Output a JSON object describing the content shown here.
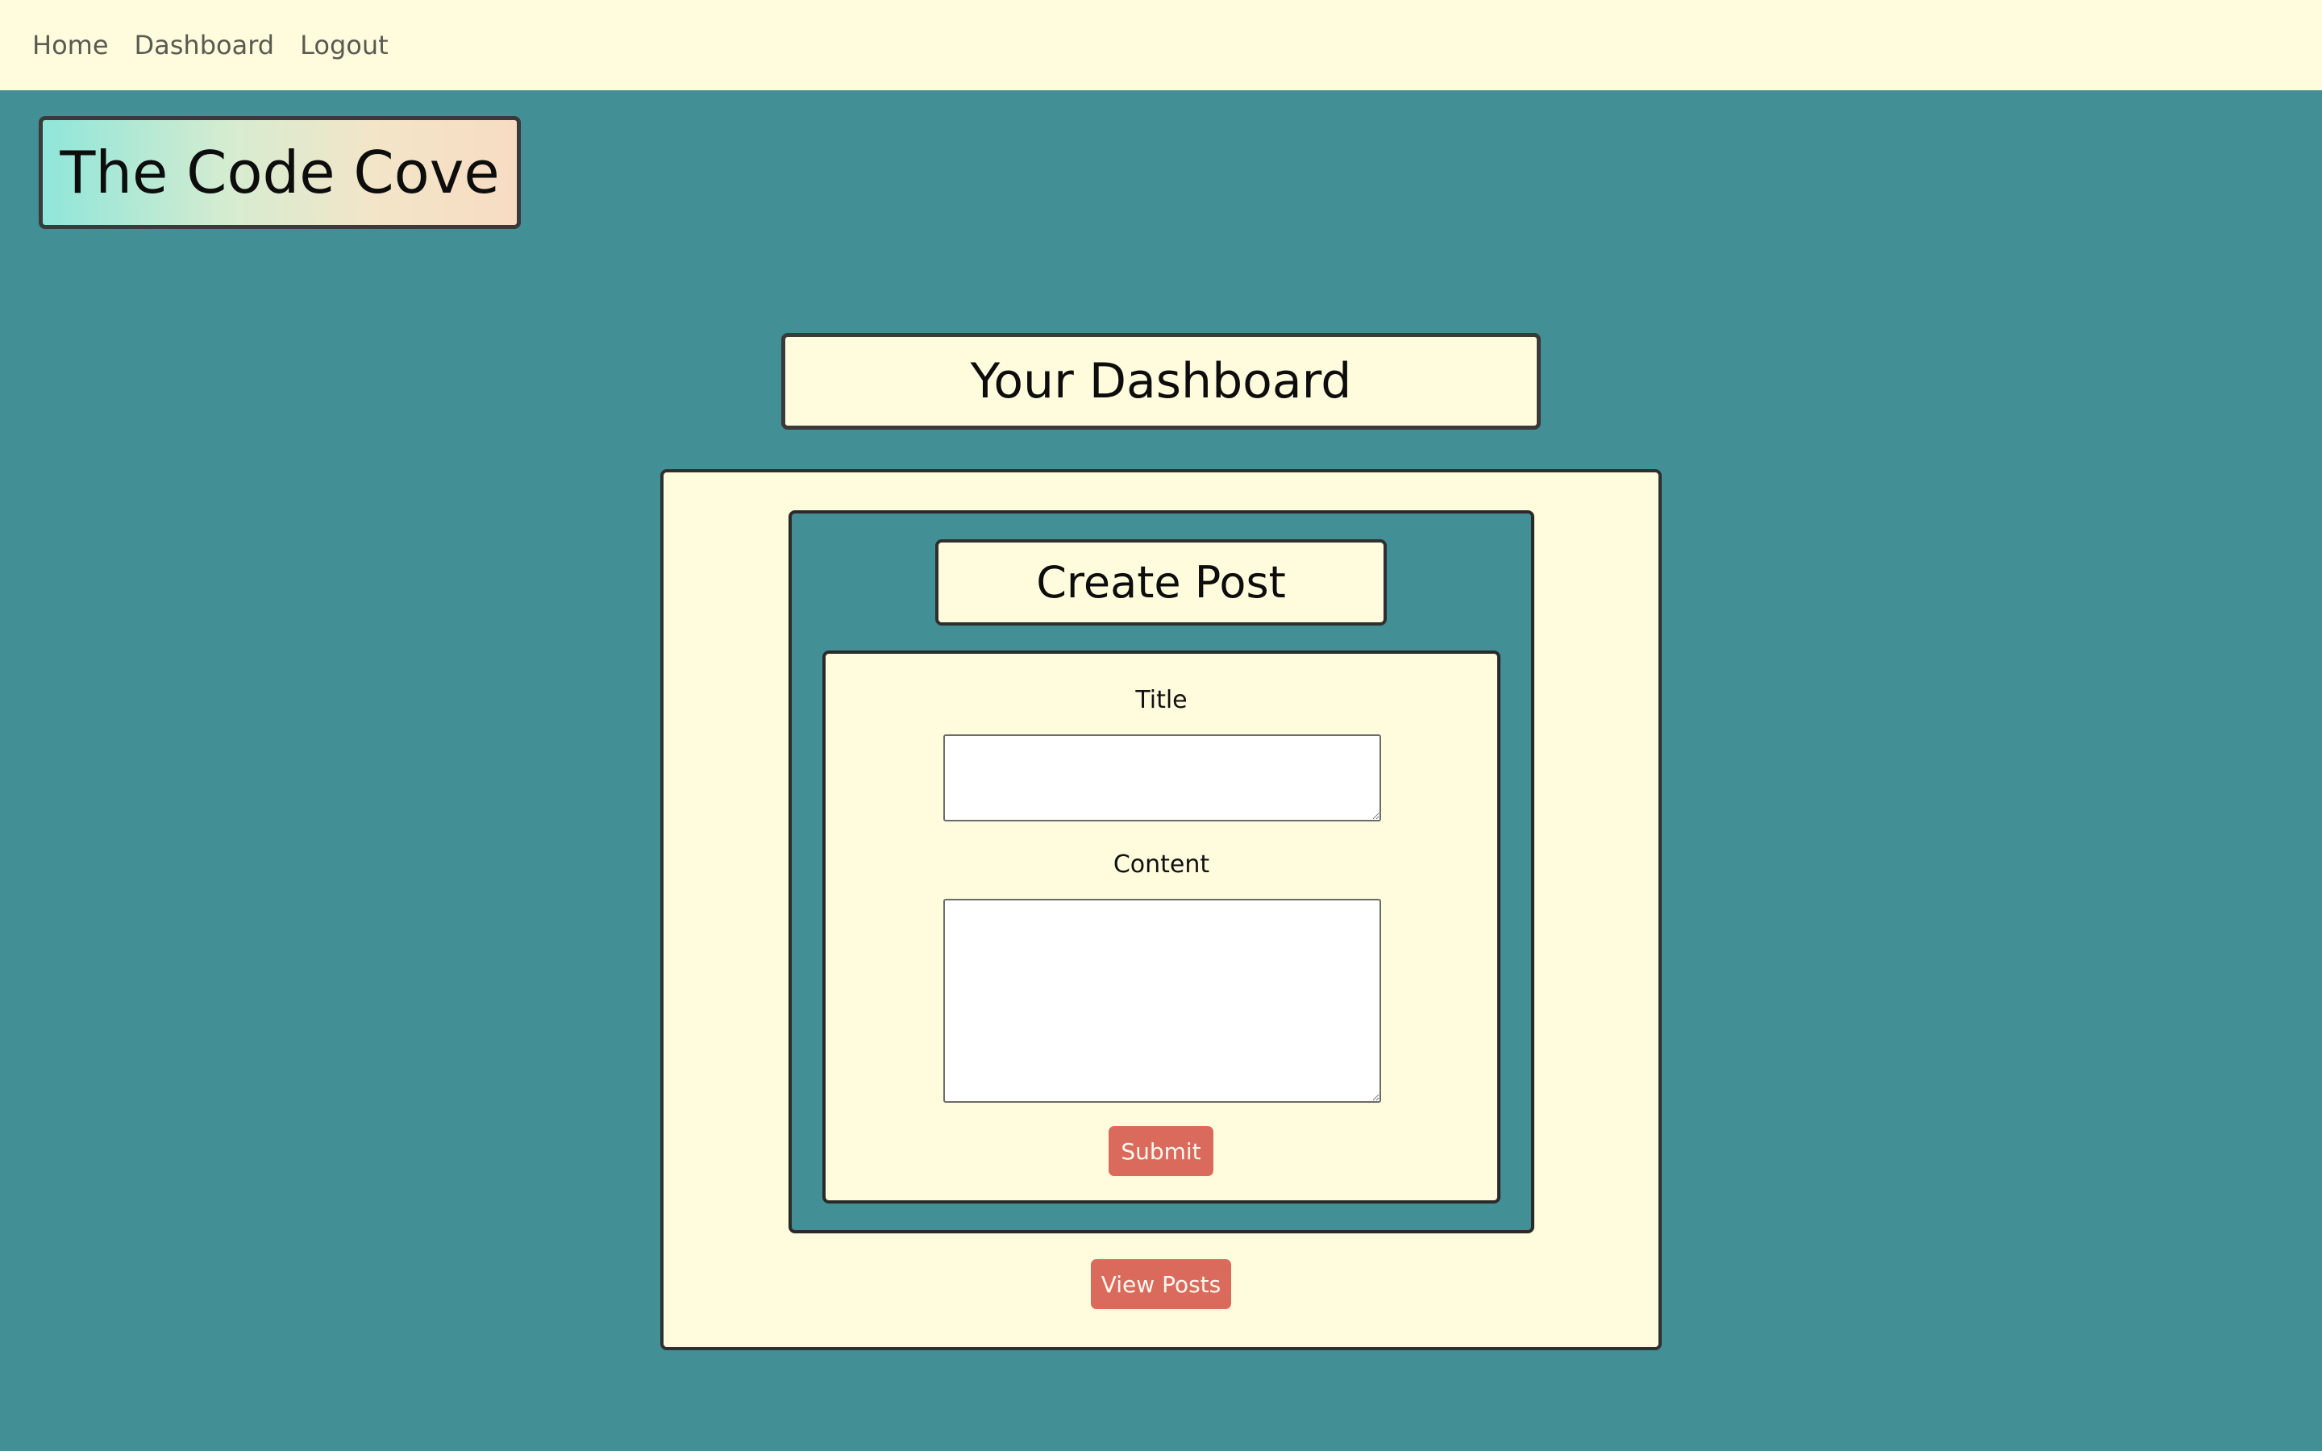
{
  "nav": {
    "items": [
      {
        "label": "Home"
      },
      {
        "label": "Dashboard"
      },
      {
        "label": "Logout"
      }
    ]
  },
  "brand": {
    "title": "The Code Cove"
  },
  "page": {
    "heading": "Your Dashboard"
  },
  "create_post": {
    "heading": "Create Post",
    "title_label": "Title",
    "title_value": "",
    "content_label": "Content",
    "content_value": "",
    "submit_label": "Submit"
  },
  "actions": {
    "view_posts_label": "View Posts"
  },
  "colors": {
    "background": "#428f96",
    "panel": "#fefcdc",
    "button": "#d96a5c",
    "border": "#2f2f2f"
  }
}
